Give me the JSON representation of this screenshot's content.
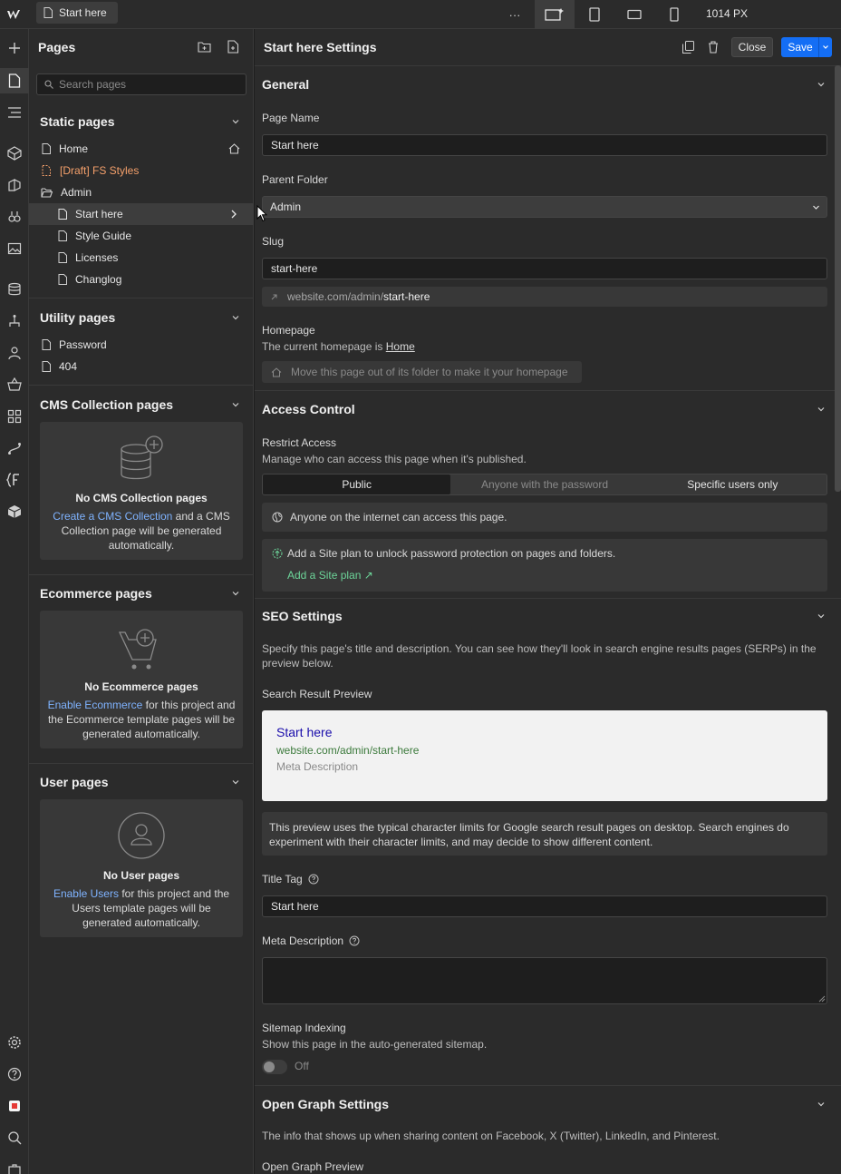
{
  "topbar": {
    "page_tab_label": "Start here",
    "more": "···",
    "px_label": "1014 PX"
  },
  "pages_panel": {
    "title": "Pages",
    "search_placeholder": "Search pages",
    "static_title": "Static pages",
    "static_pages": [
      {
        "label": "Home"
      },
      {
        "label": "[Draft] FS Styles"
      },
      {
        "label": "Admin"
      },
      {
        "label": "Start here"
      },
      {
        "label": "Style Guide"
      },
      {
        "label": "Licenses"
      },
      {
        "label": "Changlog"
      }
    ],
    "utility_title": "Utility pages",
    "utility_pages": [
      {
        "label": "Password"
      },
      {
        "label": "404"
      }
    ],
    "cms_title": "CMS Collection pages",
    "cms_empty_title": "No CMS Collection pages",
    "cms_link": "Create a CMS Collection",
    "cms_text_1": " and a CMS",
    "cms_text_2": "Collection page will be generated",
    "cms_text_3": "automatically.",
    "ecom_title": "Ecommerce pages",
    "ecom_empty_title": "No Ecommerce pages",
    "ecom_link": "Enable Ecommerce",
    "ecom_text_1": " for this project and",
    "ecom_text_2": "the Ecommerce template pages will be",
    "ecom_text_3": "generated automatically.",
    "user_title": "User pages",
    "user_empty_title": "No User pages",
    "user_link": "Enable Users",
    "user_text_1": " for this project and the",
    "user_text_2": "Users template pages will be",
    "user_text_3": "generated automatically."
  },
  "settings": {
    "title": "Start here Settings",
    "close_label": "Close",
    "save_label": "Save",
    "general": {
      "heading": "General",
      "page_name_label": "Page Name",
      "page_name_value": "Start here",
      "parent_folder_label": "Parent Folder",
      "parent_folder_value": "Admin",
      "slug_label": "Slug",
      "slug_value": "start-here",
      "url_prefix": "website.com/admin/",
      "url_slug": "start-here",
      "homepage_label": "Homepage",
      "homepage_text": "The current homepage is ",
      "homepage_link": "Home",
      "homepage_button": "Move this page out of its folder to make it your homepage"
    },
    "access": {
      "heading": "Access Control",
      "restrict_label": "Restrict Access",
      "restrict_sub": "Manage who can access this page when it's published.",
      "options": [
        "Public",
        "Anyone with the password",
        "Specific users only"
      ],
      "public_note": "Anyone on the internet can access this page.",
      "plan_note": "Add a Site plan to unlock password protection on pages and folders.",
      "plan_link": "Add a Site plan ↗"
    },
    "seo": {
      "heading": "SEO Settings",
      "desc_1": "Specify this page's title and description. You can see how they'll look in search engine results pages (SERPs) in the",
      "desc_2": "preview below.",
      "preview_label": "Search Result Preview",
      "serp_title": "Start here",
      "serp_url": "website.com/admin/start-here",
      "serp_desc": "Meta Description",
      "note_1": "This preview uses the typical character limits for Google search result pages on desktop. Search engines do",
      "note_2": "experiment with their character limits, and may decide to show different content.",
      "title_tag_label": "Title Tag",
      "title_tag_value": "Start here",
      "meta_desc_label": "Meta Description",
      "meta_desc_value": "",
      "sitemap_label": "Sitemap Indexing",
      "sitemap_sub": "Show this page in the auto-generated sitemap.",
      "sitemap_state": "Off"
    },
    "og": {
      "heading": "Open Graph Settings",
      "desc": "The info that shows up when sharing content on Facebook, X (Twitter), LinkedIn, and Pinterest.",
      "preview_label": "Open Graph Preview"
    }
  },
  "colors": {
    "accent": "#146ef5",
    "draft": "#f5a06b",
    "link": "#7fb3ff",
    "green": "#6dd69a",
    "serp_title": "#1a0dab",
    "serp_url": "#3c7a3c"
  }
}
